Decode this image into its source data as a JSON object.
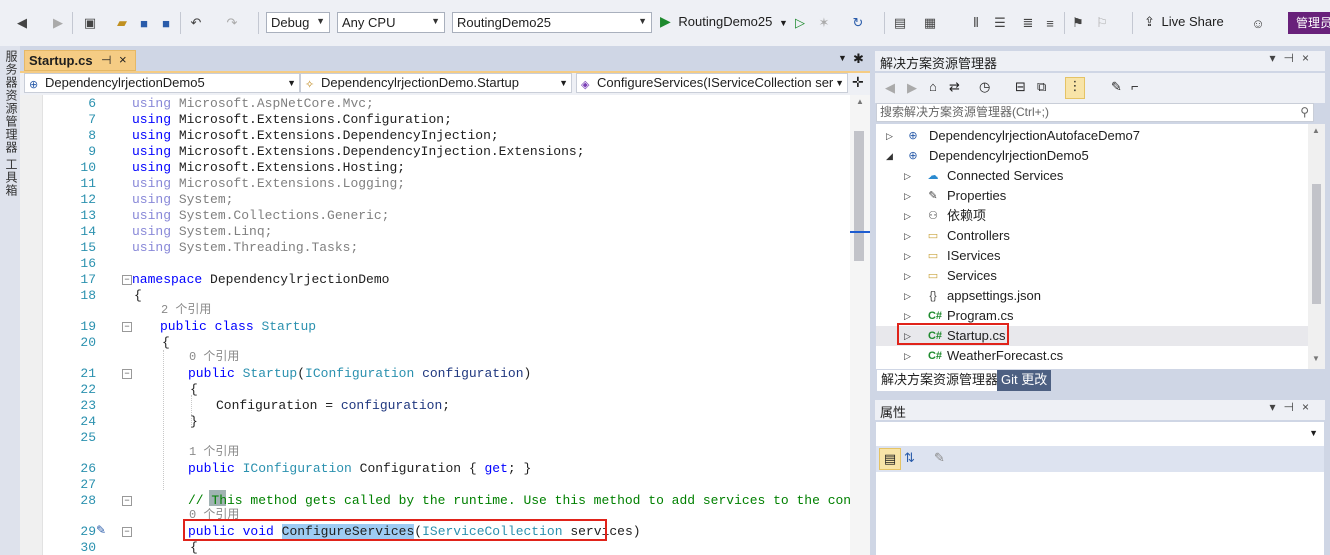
{
  "toolbar": {
    "config": "Debug",
    "platform": "Any CPU",
    "startup_project": "RoutingDemo25",
    "run_target": "RoutingDemo25",
    "live_share": "Live Share",
    "admin": "管理员"
  },
  "left_strip": {
    "server_explorer": "服务器资源管理器",
    "toolbox": "工具箱"
  },
  "document": {
    "tab_title": "Startup.cs",
    "nav_project": "DependencylrjectionDemo5",
    "nav_class": "DependencylrjectionDemo.Startup",
    "nav_member": "ConfigureServices(IServiceCollection serv"
  },
  "code": {
    "line_numbers": [
      "6",
      "7",
      "8",
      "9",
      "10",
      "11",
      "12",
      "13",
      "14",
      "15",
      "16",
      "17",
      "18",
      "19",
      "20",
      "21",
      "22",
      "23",
      "24",
      "25",
      "26",
      "27",
      "28",
      "29",
      "30"
    ],
    "using_kw": "using",
    "usings": [
      "Microsoft.AspNetCore.Mvc;",
      "Microsoft.Extensions.Configuration;",
      "Microsoft.Extensions.DependencyInjection;",
      "Microsoft.Extensions.DependencyInjection.Extensions;",
      "Microsoft.Extensions.Hosting;",
      "Microsoft.Extensions.Logging;",
      "System;",
      "System.Collections.Generic;",
      "System.Linq;",
      "System.Threading.Tasks;"
    ],
    "namespace_kw": "namespace",
    "namespace_name": "DependencylrjectionDemo",
    "open_brace": "{",
    "close_brace": "}",
    "ref_2": "2 个引用",
    "ref_0a": "0 个引用",
    "ref_1": "1 个引用",
    "ref_0b": "0 个引用",
    "public_kw": "public",
    "class_kw": "class",
    "class_name": "Startup",
    "ctor_name": "Startup",
    "iconfig_type": "IConfiguration",
    "param_configuration": "configuration",
    "paren_open": "(",
    "paren_close": ")",
    "assign_left": "Configuration = ",
    "assign_right": "configuration",
    "semicolon": ";",
    "prop_name": " Configuration { ",
    "get_kw": "get",
    "prop_end": "; }",
    "comment": "// This method gets called by the runtime. Use this method to add services to the container.",
    "void_kw": "void",
    "method_name": "ConfigureServices",
    "svc_type": "IServiceCollection",
    "svc_param": " services)"
  },
  "solution_explorer": {
    "title": "解决方案资源管理器",
    "search_placeholder": "搜索解决方案资源管理器(Ctrl+;)",
    "items": [
      {
        "label": "DependencylrjectionAutofaceDemo7"
      },
      {
        "label": "DependencylrjectionDemo5"
      },
      {
        "label": "Connected Services"
      },
      {
        "label": "Properties"
      },
      {
        "label": "依赖项"
      },
      {
        "label": "Controllers"
      },
      {
        "label": "IServices"
      },
      {
        "label": "Services"
      },
      {
        "label": "appsettings.json"
      },
      {
        "label": "Program.cs"
      },
      {
        "label": "Startup.cs"
      },
      {
        "label": "WeatherForecast.cs"
      }
    ],
    "csharp_icon": "C#",
    "tab_active": "解决方案资源管理器",
    "tab_git": "Git 更改"
  },
  "properties": {
    "title": "属性"
  },
  "colors": {
    "accent_tab": "#f5cc84",
    "highlight_box": "#e0231a",
    "selection": "#9ecbf3"
  }
}
